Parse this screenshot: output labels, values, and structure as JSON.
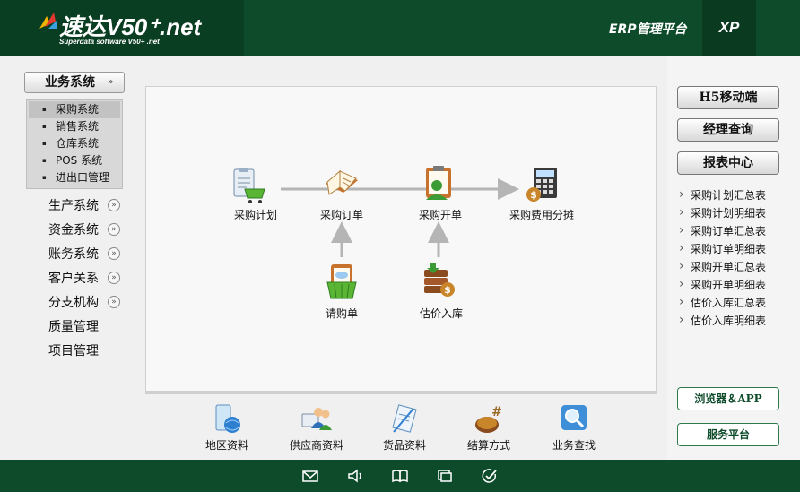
{
  "header": {
    "logo_main": "速达V50⁺.net",
    "logo_sub": "Superdata software V50+ .net",
    "platform_title": "ERP管理平台",
    "edition": "XP"
  },
  "sidebar": {
    "system_button": "业务系统",
    "submenu": [
      "采购系统",
      "销售系统",
      "仓库系统",
      "POS 系统",
      "进出口管理"
    ],
    "items": [
      {
        "label": "生产系统",
        "expandable": true
      },
      {
        "label": "资金系统",
        "expandable": true
      },
      {
        "label": "账务系统",
        "expandable": true
      },
      {
        "label": "客户关系",
        "expandable": true
      },
      {
        "label": "分支机构",
        "expandable": true
      },
      {
        "label": "质量管理",
        "expandable": false
      },
      {
        "label": "项目管理",
        "expandable": false
      }
    ]
  },
  "flow": {
    "plan": "采购计划",
    "order": "采购订单",
    "invoice": "采购开单",
    "cost": "采购费用分摊",
    "request": "请购单",
    "estimate": "估价入库"
  },
  "tools": [
    "地区资料",
    "供应商资料",
    "货品资料",
    "结算方式",
    "业务查找"
  ],
  "right": {
    "buttons": [
      "H5移动端",
      "经理查询",
      "报表中心"
    ],
    "reports": [
      "采购计划汇总表",
      "采购计划明细表",
      "采购订单汇总表",
      "采购订单明细表",
      "采购开单汇总表",
      "采购开单明细表",
      "估价入库汇总表",
      "估价入库明细表"
    ],
    "bottom_buttons": [
      "浏览器＆APP",
      "服务平台"
    ]
  },
  "colors": {
    "brand_green": "#0e4b2a",
    "accent_green": "#2f7a4a"
  }
}
